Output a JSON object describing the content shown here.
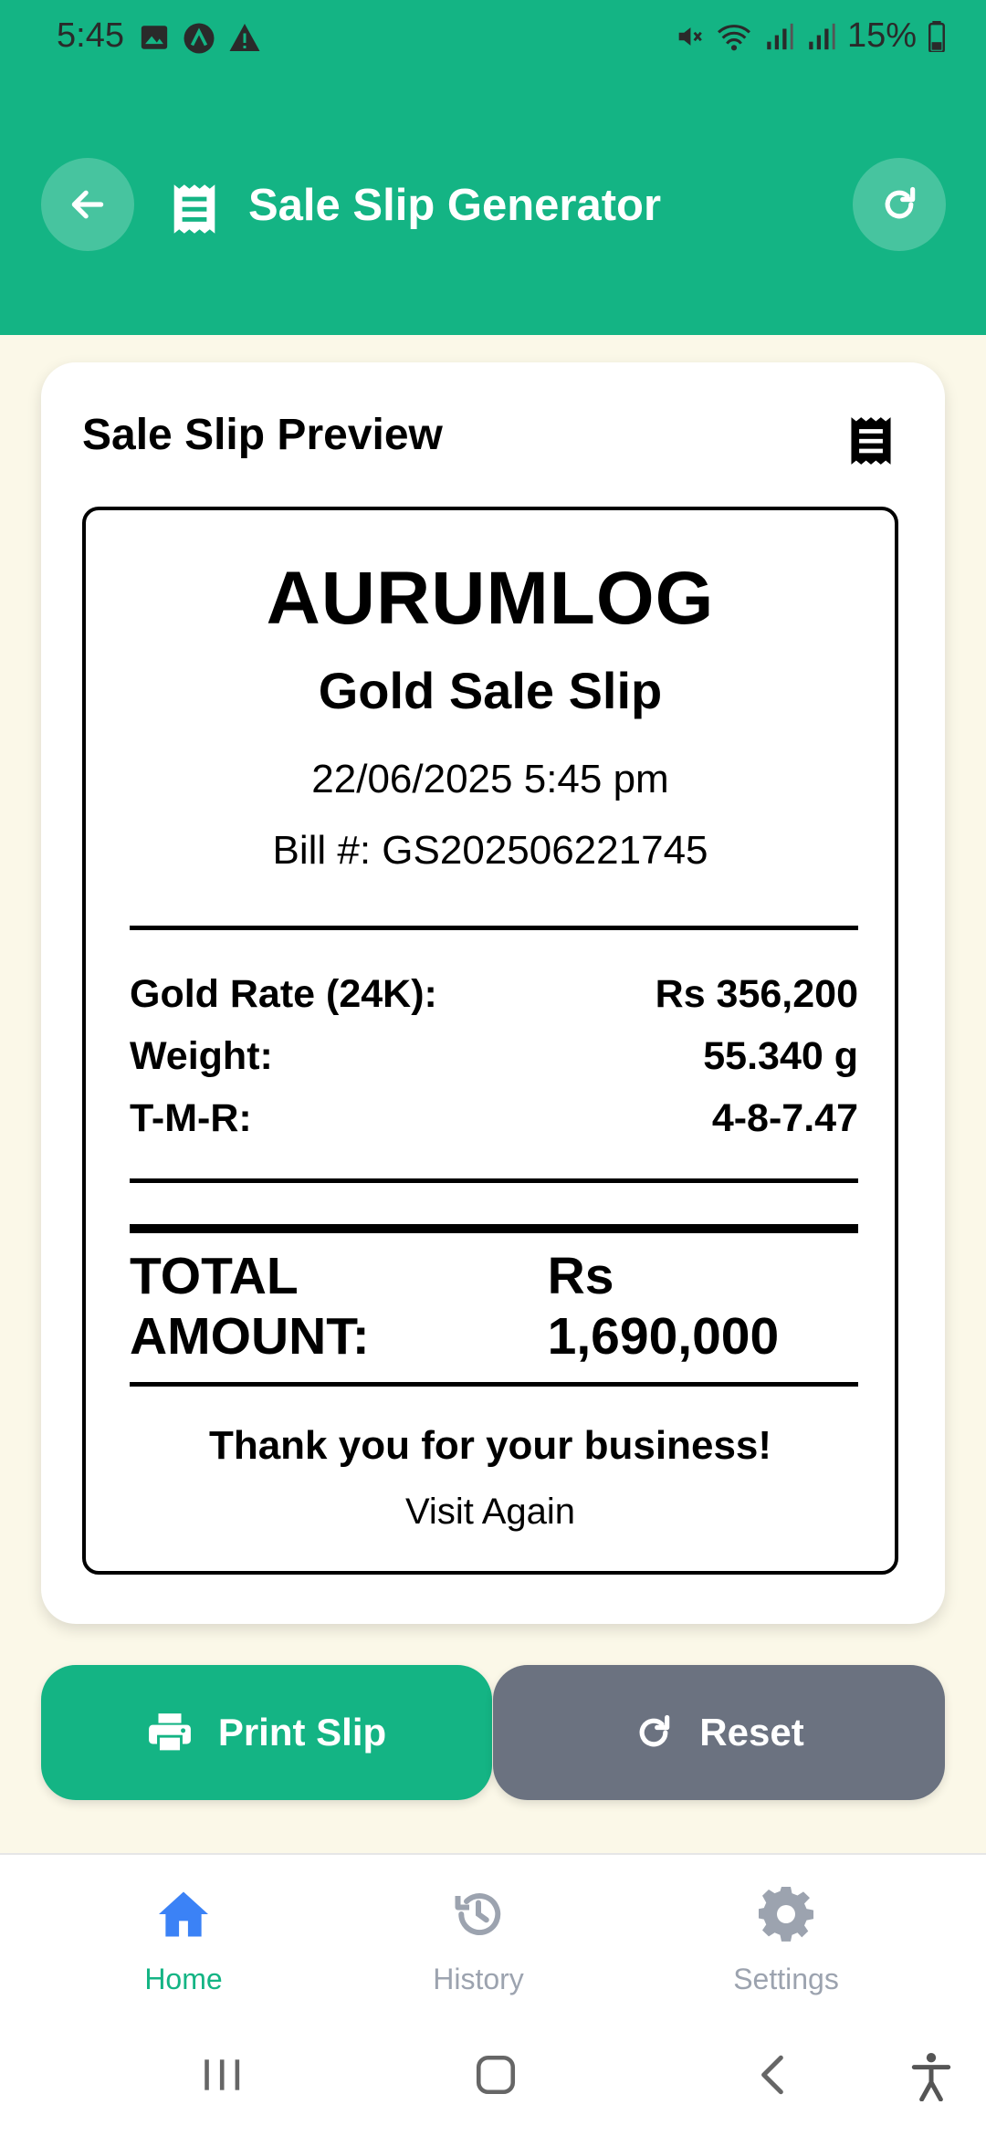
{
  "status_bar": {
    "time": "5:45",
    "left_icons": [
      "image-icon",
      "app-a-icon",
      "warning-icon"
    ],
    "right_icons": [
      "mute-icon",
      "wifi-icon",
      "signal-icon",
      "signal-icon",
      "battery-icon"
    ],
    "battery": "15%"
  },
  "app_bar": {
    "title": "Sale Slip Generator",
    "back_icon": "arrow-left-icon",
    "title_icon": "receipt-icon",
    "refresh_icon": "refresh-icon"
  },
  "preview": {
    "title": "Sale Slip Preview",
    "icon": "receipt-icon"
  },
  "slip": {
    "brand": "AURUMLOG",
    "subtitle": "Gold Sale Slip",
    "datetime": "22/06/2025 5:45 pm",
    "bill": "Bill #: GS202506221745",
    "rows": [
      {
        "label": "Gold Rate (24K):",
        "value": "Rs 356,200"
      },
      {
        "label": "Weight:",
        "value": "55.340 g"
      },
      {
        "label": "T-M-R:",
        "value": "4-8-7.47"
      }
    ],
    "total_label": "TOTAL AMOUNT:",
    "total_value": "Rs 1,690,000",
    "thanks": "Thank you for your business!",
    "visit": "Visit Again"
  },
  "actions": {
    "print_label": "Print Slip",
    "reset_label": "Reset"
  },
  "bottom_nav": {
    "items": [
      {
        "label": "Home",
        "icon": "home-icon",
        "active": true
      },
      {
        "label": "History",
        "icon": "history-icon",
        "active": false
      },
      {
        "label": "Settings",
        "icon": "gear-icon",
        "active": false
      }
    ]
  },
  "colors": {
    "primary": "#14b484",
    "background": "#fbf8e8",
    "reset_button": "#6b7280",
    "nav_active_icon": "#3b82f6",
    "nav_inactive": "#9ca3af"
  }
}
